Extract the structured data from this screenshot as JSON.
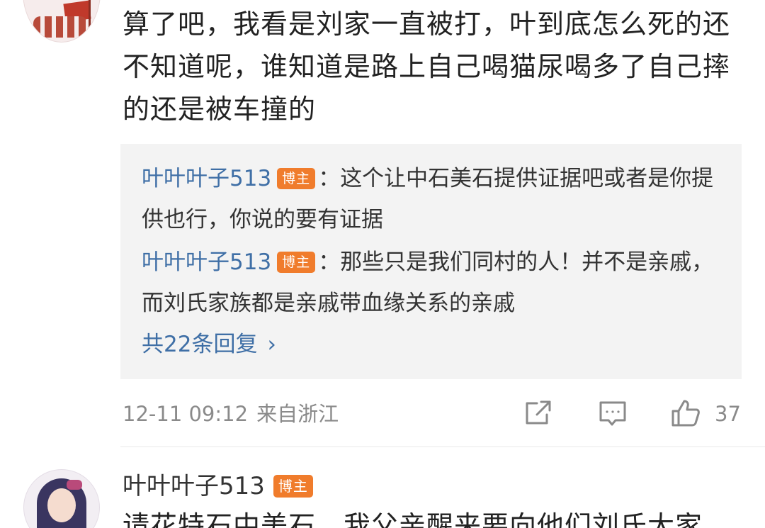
{
  "comment1": {
    "text": "算了吧，我看是刘家一直被打，叶到底怎么死的还不知道呢，谁知道是路上自己喝猫尿喝多了自己摔的还是被车撞的",
    "replies": [
      {
        "user": "叶叶叶子513",
        "badge": "博主",
        "sep": "：",
        "text": "这个让中石美石提供证据吧或者是你提供也行，你说的要有证据"
      },
      {
        "user": "叶叶叶子513",
        "badge": "博主",
        "sep": "：",
        "text": "那些只是我们同村的人！并不是亲戚，而刘氏家族都是亲戚带血缘关系的亲戚"
      }
    ],
    "more_replies": "共22条回复",
    "more_chevron": "›",
    "time": "12-11 09:12",
    "location": "来自浙江",
    "like_count": "37",
    "icons": {
      "share": "share-icon",
      "reply": "comment-icon",
      "like": "thumbs-up-icon"
    }
  },
  "comment2": {
    "user": "叶叶叶子513",
    "badge": "博主",
    "text_partial": "请花特石中美石，我父亲醒来要向他们刘氏大家"
  },
  "colors": {
    "link": "#3f6fa6",
    "badge": "#f07c2c",
    "reply_bg": "#f3f3f3",
    "meta": "#8a8a8a"
  }
}
